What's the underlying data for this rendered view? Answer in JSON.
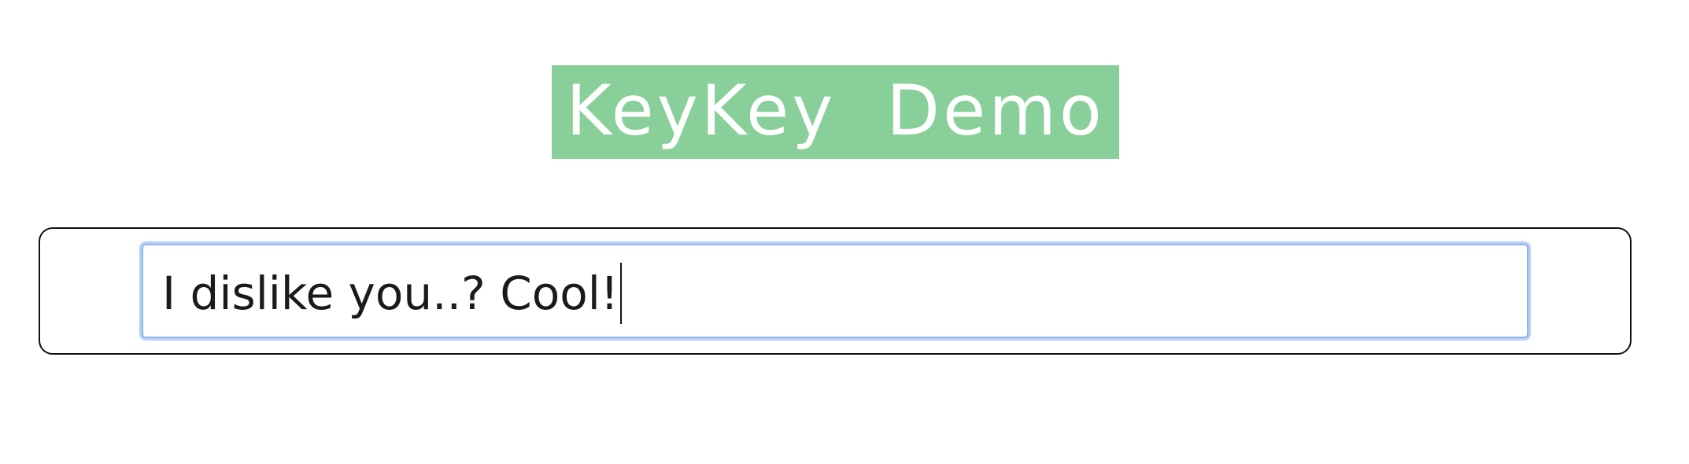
{
  "header": {
    "title": "KeyKey  Demo",
    "background_color": "#88cf99",
    "text_color": "#ffffff"
  },
  "input": {
    "value": "I dislike you..? Cool!",
    "focus_color": "#8fb4ee"
  }
}
